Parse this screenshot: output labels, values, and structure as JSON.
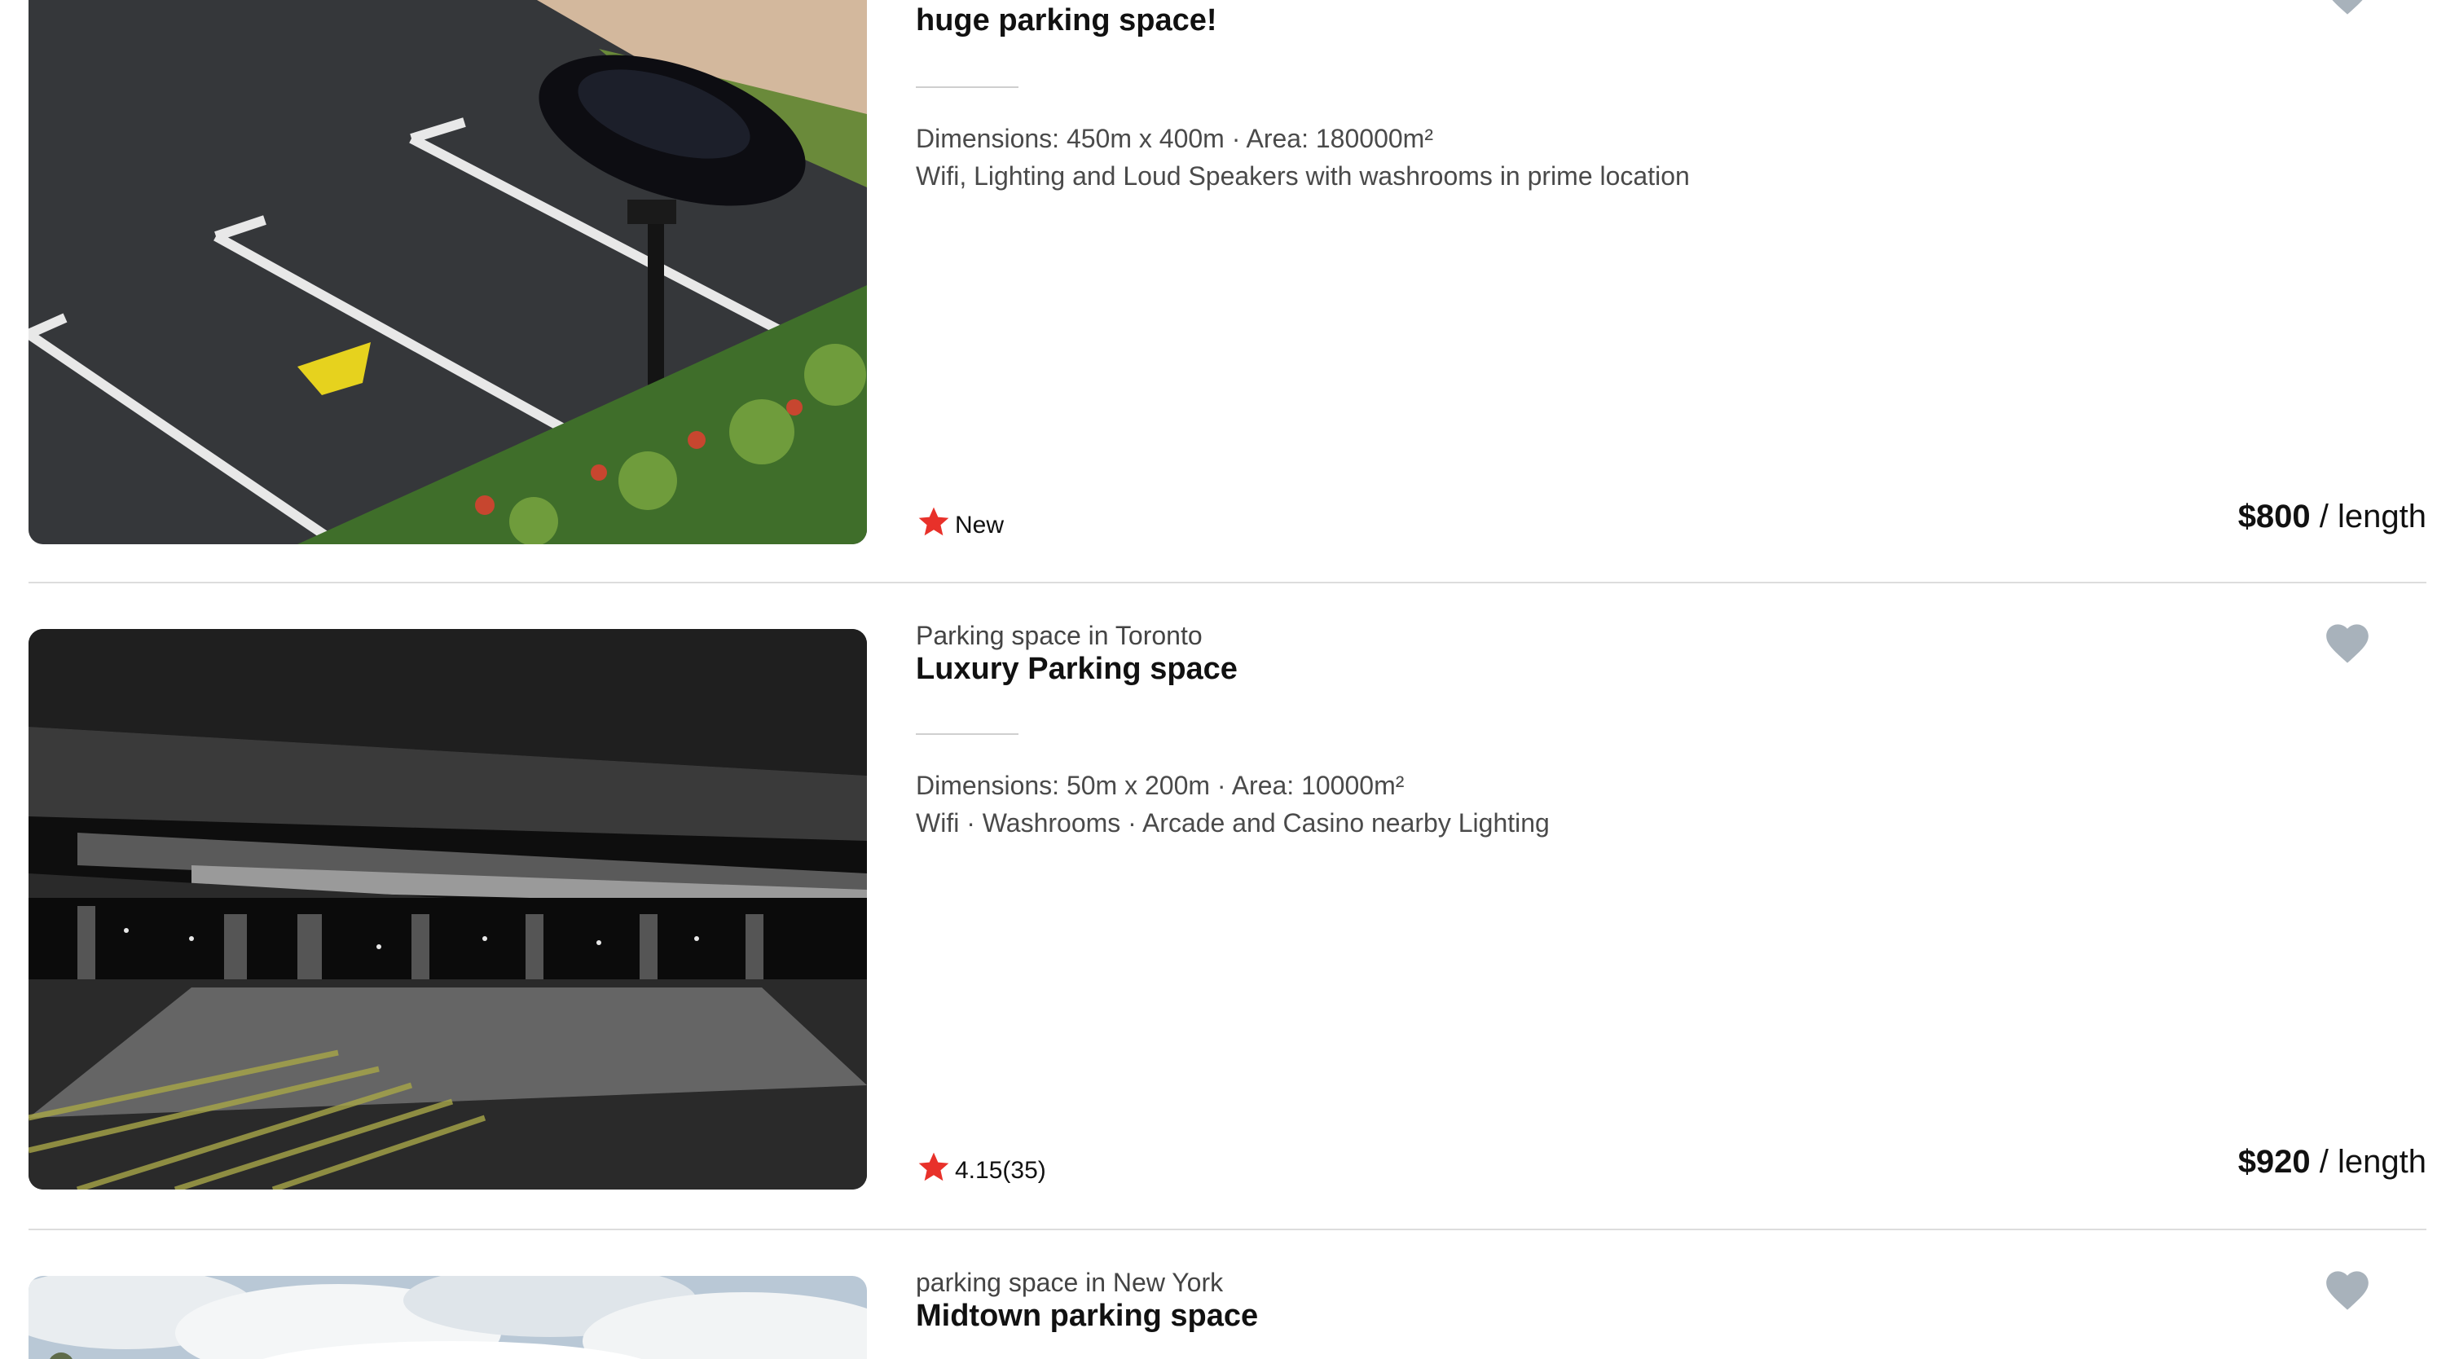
{
  "colors": {
    "accent_star": "#e8312a",
    "heart": "#a8b2bb",
    "divider": "#dddddd"
  },
  "listings": [
    {
      "subtitle": "",
      "title": "huge parking space!",
      "dimensions": "Dimensions: 450m x 400m · Area: 180000m²",
      "amenities": "Wifi, Lighting and Loud Speakers with washrooms in prime location",
      "rating": "New",
      "price_amount": "$800",
      "price_unit": " / length",
      "image_alt": "Outdoor parking lot with black sedan",
      "favorite_icon": "heart-icon",
      "rating_icon": "star-icon"
    },
    {
      "subtitle": "Parking space in Toronto",
      "title": "Luxury Parking space",
      "dimensions": "Dimensions: 50m x 200m · Area: 10000m²",
      "amenities": "Wifi · Washrooms · Arcade and Casino nearby Lighting",
      "rating": "4.15(35)",
      "price_amount": "$920",
      "price_unit": " / length",
      "image_alt": "Underground parking garage at night",
      "favorite_icon": "heart-icon",
      "rating_icon": "star-icon"
    },
    {
      "subtitle": "parking space in New York",
      "title": "Midtown parking space",
      "image_alt": "Parking space under cloudy sky",
      "favorite_icon": "heart-icon"
    }
  ]
}
